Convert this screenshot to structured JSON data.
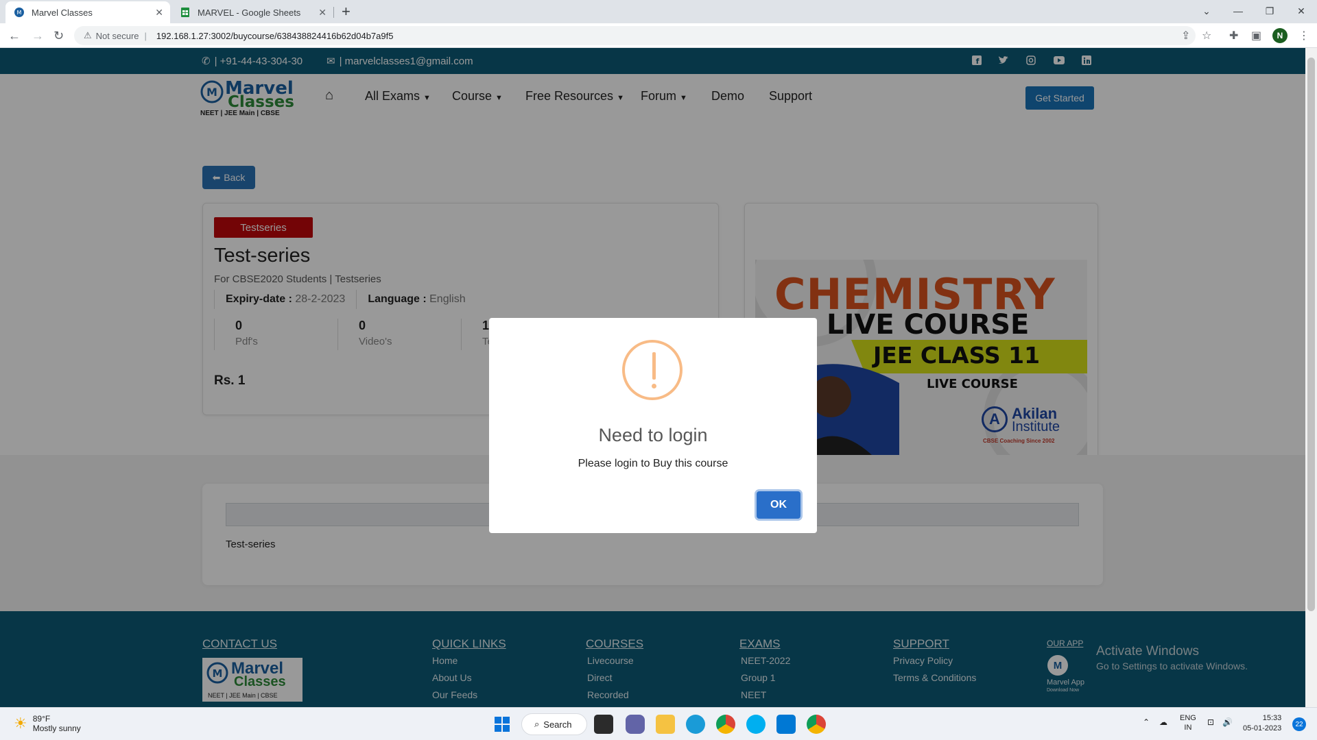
{
  "browser": {
    "tabs": [
      {
        "title": "Marvel Classes",
        "active": true
      },
      {
        "title": "MARVEL - Google Sheets",
        "active": false
      }
    ],
    "security_label": "Not secure",
    "url": "192.168.1.27:3002/buycourse/638438824416b62d04b7a9f5",
    "profile_initial": "N"
  },
  "topbar": {
    "phone": "| +91-44-43-304-30",
    "email": "| marvelclasses1@gmail.com",
    "social_icons": [
      "facebook-icon",
      "twitter-icon",
      "instagram-icon",
      "youtube-icon",
      "linkedin-icon"
    ]
  },
  "logo": {
    "line1": "Marvel",
    "line2": "Classes",
    "tagline": "NEET | JEE Main | CBSE"
  },
  "nav": {
    "items": [
      "All Exams",
      "Course",
      "Free Resources",
      "Forum",
      "Demo",
      "Support"
    ],
    "cta": "Get Started"
  },
  "back_label": "Back",
  "course": {
    "badge": "Testseries",
    "title": "Test-series",
    "subtitle": "For CBSE2020 Students | Testseries",
    "expiry_label": "Expiry-date :",
    "expiry_value": "28-2-2023",
    "language_label": "Language :",
    "language_value": "English",
    "stats": [
      {
        "num": "0",
        "label": "Pdf's"
      },
      {
        "num": "0",
        "label": "Video's"
      },
      {
        "num": "1",
        "label": "Te"
      }
    ],
    "price": "Rs. 1"
  },
  "banner": {
    "line1": "CHEMISTRY",
    "line2": "LIVE COURSE",
    "line3": "JEE CLASS 11",
    "line4": "LIVE COURSE",
    "brand": "Akilan",
    "brand2": "Institute",
    "brand_tag": "CBSE Coaching Since 2002"
  },
  "description": {
    "header": "Test-series",
    "body": "Test-series"
  },
  "footer": {
    "contact": "CONTACT US",
    "quick_links": {
      "title": "QUICK LINKS",
      "items": [
        "Home",
        "About Us",
        "Our Feeds"
      ]
    },
    "courses": {
      "title": "COURSES",
      "items": [
        "Livecourse",
        "Direct",
        "Recorded"
      ]
    },
    "exams": {
      "title": "EXAMS",
      "items": [
        "NEET-2022",
        "Group 1",
        "NEET"
      ]
    },
    "support": {
      "title": "SUPPORT",
      "items": [
        "Privacy Policy",
        "Terms & Conditions"
      ]
    },
    "app": {
      "title": "OUR APP",
      "label": "Marvel App",
      "sub": "Download Now"
    }
  },
  "watermark": {
    "line1": "Activate Windows",
    "line2": "Go to Settings to activate Windows."
  },
  "modal": {
    "title": "Need to login",
    "text": "Please login to Buy this course",
    "ok": "OK"
  },
  "taskbar": {
    "temp": "89°F",
    "weather": "Mostly sunny",
    "search": "Search",
    "lang1": "ENG",
    "lang2": "IN",
    "time": "15:33",
    "date": "05-01-2023",
    "badge": "22"
  },
  "colors": {
    "brand_teal": "#0c5a77",
    "badge_red": "#c0080a",
    "button_blue": "#2a72b5",
    "warning": "#f8bb86"
  }
}
